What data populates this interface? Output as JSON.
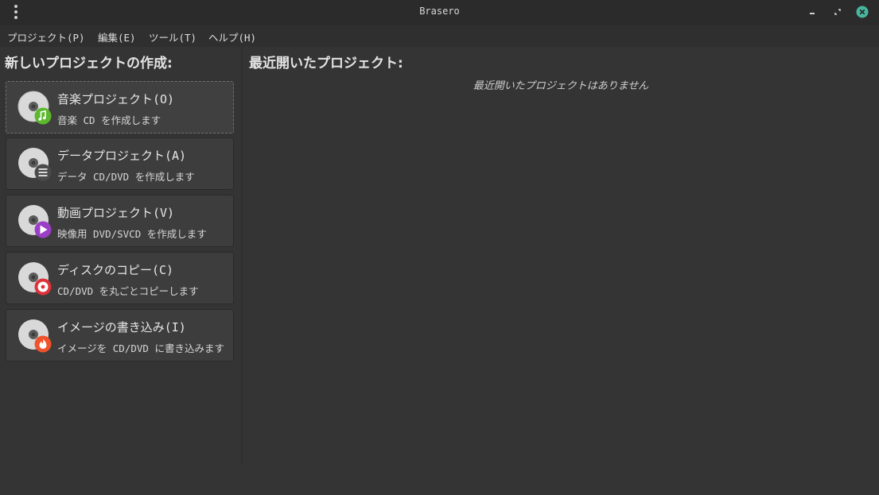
{
  "window": {
    "title": "Brasero",
    "menu_icon": "kebab-menu-icon",
    "minimize_icon": "minimize-icon",
    "restore_icon": "restore-icon",
    "close_icon": "close-icon"
  },
  "menubar": {
    "items": [
      {
        "label": "プロジェクト(P)"
      },
      {
        "label": "編集(E)"
      },
      {
        "label": "ツール(T)"
      },
      {
        "label": "ヘルプ(H)"
      }
    ]
  },
  "new_project": {
    "title": "新しいプロジェクトの作成:",
    "items": [
      {
        "label": "音楽プロジェクト(O)",
        "desc": "音楽 CD を作成します",
        "badge_icon": "music-note-icon",
        "badge_color": "#5cb82c"
      },
      {
        "label": "データプロジェクト(A)",
        "desc": "データ CD/DVD を作成します",
        "badge_icon": "list-icon",
        "badge_color": "#4a4a4a"
      },
      {
        "label": "動画プロジェクト(V)",
        "desc": "映像用 DVD/SVCD を作成します",
        "badge_icon": "play-icon",
        "badge_color": "#9b3fc7"
      },
      {
        "label": "ディスクのコピー(C)",
        "desc": "CD/DVD を丸ごとコピーします",
        "badge_icon": "disc-copy-icon",
        "badge_color": "#e0313a"
      },
      {
        "label": "イメージの書き込み(I)",
        "desc": "イメージを CD/DVD に書き込みます",
        "badge_icon": "flame-icon",
        "badge_color": "#f0522a"
      }
    ]
  },
  "recent": {
    "title": "最近開いたプロジェクト:",
    "empty_message": "最近開いたプロジェクトはありません"
  },
  "colors": {
    "background": "#343434",
    "titlebar": "#2b2b2b",
    "close_accent": "#47b7a0"
  }
}
